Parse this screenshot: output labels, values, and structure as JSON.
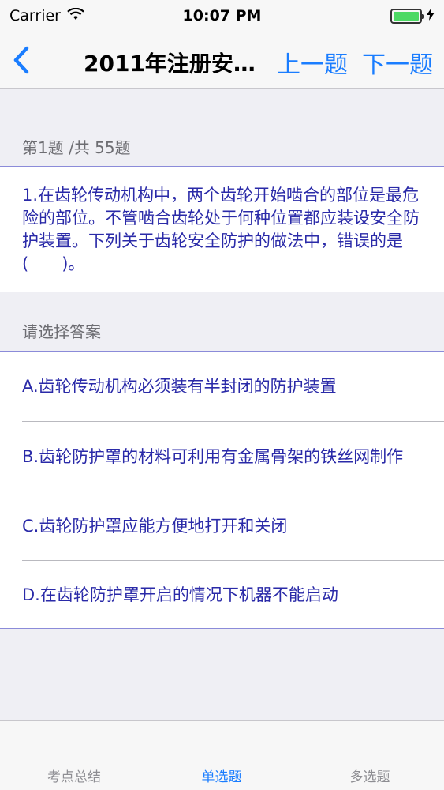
{
  "status": {
    "carrier": "Carrier",
    "time": "10:07 PM"
  },
  "nav": {
    "title": "2011年注册安…",
    "prev": "上一题",
    "next": "下一题"
  },
  "question": {
    "progress": "第1题 /共 55题",
    "text": "1.在齿轮传动机构中，两个齿轮开始啮合的部位是最危险的部位。不管啮合齿轮处于何种位置都应装设安全防护装置。下列关于齿轮安全防护的做法中，错误的是(　　)。",
    "answer_header": "请选择答案"
  },
  "options": [
    "A.齿轮传动机构必须装有半封闭的防护装置",
    "B.齿轮防护罩的材料可利用有金属骨架的铁丝网制作",
    "C.齿轮防护罩应能方便地打开和关闭",
    "D.在齿轮防护罩开启的情况下机器不能启动"
  ],
  "tabs": {
    "summary": "考点总结",
    "single": "单选题",
    "multi": "多选题"
  },
  "colors": {
    "accent": "#1a7dff",
    "question_text": "#2a2aa8"
  }
}
